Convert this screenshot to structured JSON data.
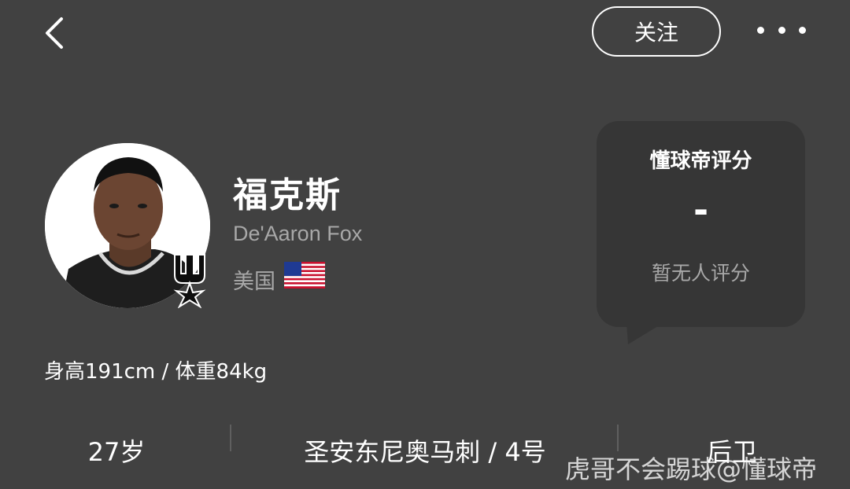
{
  "topbar": {
    "back_icon": "chevron-left-icon",
    "follow_label": "关注",
    "more_icon": "more-dots-icon"
  },
  "player": {
    "name_cn": "福克斯",
    "name_en": "De'Aaron Fox",
    "country": "美国",
    "flag_icon": "us-flag-icon",
    "team_badge_icon": "spurs-logo-icon",
    "body_info": "身高191cm / 体重84kg"
  },
  "rating": {
    "title": "懂球帝评分",
    "value": "-",
    "empty_text": "暂无人评分"
  },
  "stats": {
    "age": "27岁",
    "team_number": "圣安东尼奥马刺 / 4号",
    "position": "后卫"
  },
  "watermark": "虎哥不会踢球@懂球帝",
  "colors": {
    "background": "#414141",
    "card": "#363636",
    "muted_text": "#a8a8a8"
  }
}
